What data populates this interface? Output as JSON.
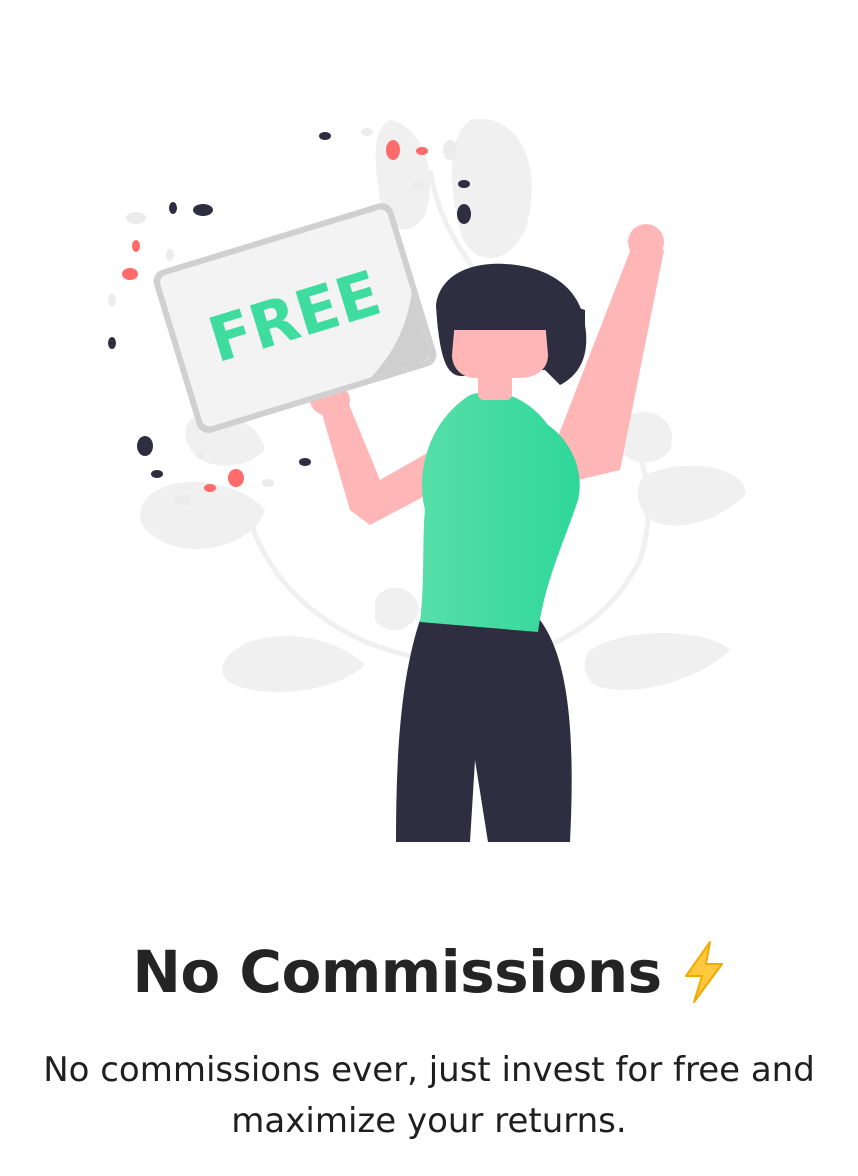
{
  "sign": {
    "text": "FREE"
  },
  "title": {
    "text": "No Commissions",
    "icon": "lightning-bolt-icon"
  },
  "description": {
    "text": "No commissions ever, just invest for free and maximize your returns."
  },
  "colors": {
    "accent_green": "#2fd898",
    "dark": "#2f2e41",
    "skin": "#ffb6b6",
    "leaf": "#f2f2f2",
    "confetti_red": "#ff6a6a"
  }
}
